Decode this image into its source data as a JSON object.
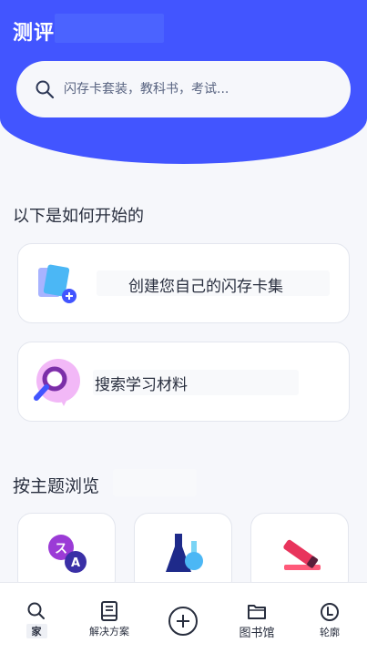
{
  "header": {
    "title": "测评",
    "background_color": "#4255ff"
  },
  "search": {
    "placeholder": "闪存卡套装，教科书，考试...",
    "icon": "search-icon"
  },
  "getting_started": {
    "title": "以下是如何开始的",
    "cards": [
      {
        "label": "创建您自己的闪存卡集",
        "icon": "create-flashcards-icon"
      },
      {
        "label": "搜索学习材料",
        "icon": "search-materials-icon"
      }
    ]
  },
  "browse": {
    "title": "按主题浏览",
    "topics": [
      {
        "icon": "languages-icon"
      },
      {
        "icon": "science-icon"
      },
      {
        "icon": "arts-icon"
      }
    ]
  },
  "bottom_nav": {
    "items": [
      {
        "label": "家",
        "icon": "home-search-icon",
        "active": true
      },
      {
        "label": "解决方案",
        "icon": "book-icon",
        "active": false
      },
      {
        "label": "",
        "icon": "create-plus-icon",
        "active": false
      },
      {
        "label": "图书馆",
        "icon": "folder-icon",
        "active": false
      },
      {
        "label": "轮廓",
        "icon": "profile-icon",
        "active": false
      }
    ]
  }
}
